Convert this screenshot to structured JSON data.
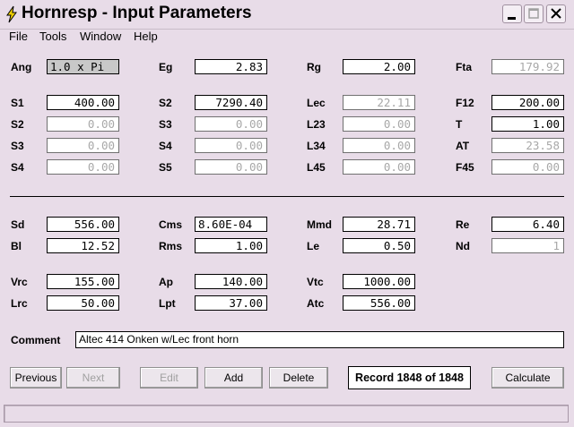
{
  "window": {
    "title": "Hornresp - Input Parameters"
  },
  "menu": [
    "File",
    "Tools",
    "Window",
    "Help"
  ],
  "params": {
    "ang": {
      "label": "Ang",
      "value": "1.0 x Pi"
    },
    "eg": {
      "label": "Eg",
      "value": "2.83"
    },
    "rg": {
      "label": "Rg",
      "value": "2.00"
    },
    "fta": {
      "label": "Fta",
      "value": "179.92"
    },
    "s1a": {
      "label": "S1",
      "value": "400.00"
    },
    "s2a": {
      "label": "S2",
      "value": "7290.40"
    },
    "lec": {
      "label": "Lec",
      "value": "22.11"
    },
    "f12": {
      "label": "F12",
      "value": "200.00"
    },
    "s2b": {
      "label": "S2",
      "value": "0.00"
    },
    "s3a": {
      "label": "S3",
      "value": "0.00"
    },
    "l23": {
      "label": "L23",
      "value": "0.00"
    },
    "t": {
      "label": "T",
      "value": "1.00"
    },
    "s3b": {
      "label": "S3",
      "value": "0.00"
    },
    "s4a": {
      "label": "S4",
      "value": "0.00"
    },
    "l34": {
      "label": "L34",
      "value": "0.00"
    },
    "at": {
      "label": "AT",
      "value": "23.58"
    },
    "s4b": {
      "label": "S4",
      "value": "0.00"
    },
    "s5": {
      "label": "S5",
      "value": "0.00"
    },
    "l45": {
      "label": "L45",
      "value": "0.00"
    },
    "f45": {
      "label": "F45",
      "value": "0.00"
    },
    "sd": {
      "label": "Sd",
      "value": "556.00"
    },
    "cms": {
      "label": "Cms",
      "value": "8.60E-04"
    },
    "mmd": {
      "label": "Mmd",
      "value": "28.71"
    },
    "re": {
      "label": "Re",
      "value": "6.40"
    },
    "bl": {
      "label": "Bl",
      "value": "12.52"
    },
    "rms": {
      "label": "Rms",
      "value": "1.00"
    },
    "le": {
      "label": "Le",
      "value": "0.50"
    },
    "nd": {
      "label": "Nd",
      "value": "1"
    },
    "vrc": {
      "label": "Vrc",
      "value": "155.00"
    },
    "ap": {
      "label": "Ap",
      "value": "140.00"
    },
    "vtc": {
      "label": "Vtc",
      "value": "1000.00"
    },
    "lrc": {
      "label": "Lrc",
      "value": "50.00"
    },
    "lpt": {
      "label": "Lpt",
      "value": "37.00"
    },
    "atc": {
      "label": "Atc",
      "value": "556.00"
    }
  },
  "comment": {
    "label": "Comment",
    "value": "Altec 414 Onken w/Lec front horn"
  },
  "buttons": {
    "previous": "Previous",
    "next": "Next",
    "edit": "Edit",
    "add": "Add",
    "delete": "Delete",
    "calculate": "Calculate"
  },
  "record": "Record 1848 of 1848"
}
